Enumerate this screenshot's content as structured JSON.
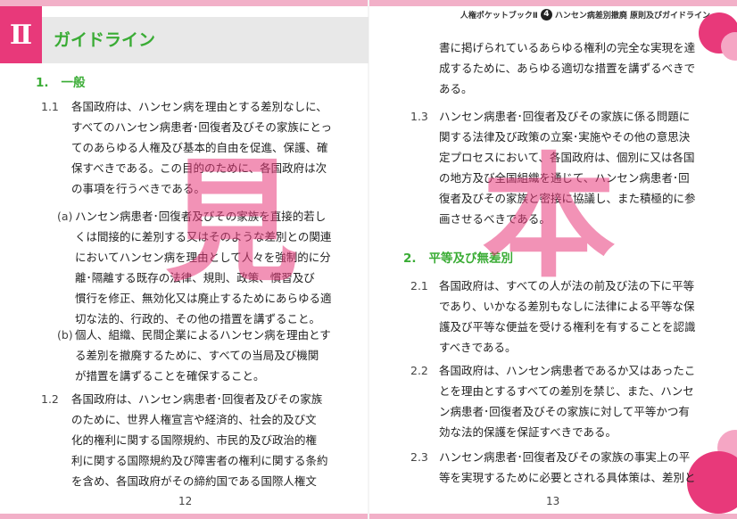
{
  "header": {
    "chapter_badge": "Ⅱ",
    "chapter_title": "ガイドライン",
    "running_title": "人権ポケットブックⅡ",
    "running_num": "4",
    "running_subtitle": "ハンセン病差別撤廃 原則及びガイドライン"
  },
  "left_page": {
    "section1": {
      "num": "1.",
      "title": "一般"
    },
    "p1_1": {
      "num": "1.1",
      "lines": [
        "各国政府は、ハンセン病を理由とする差別なしに、",
        "すべてのハンセン病患者･回復者及びその家族にとっ",
        "てのあらゆる人権及び基本的自由を促進、保護、確",
        "保すべきである。この目的のために、各国政府は次",
        "の事項を行うべきである。"
      ]
    },
    "item_a": {
      "label": "(a)",
      "lines": [
        "ハンセン病患者･回復者及びその家族を直接的若し",
        "くは間接的に差別する又はそのような差別との関連",
        "においてハンセン病を理由として人々を強制的に分",
        "離･隔離する既存の法律、規則、政策、慣習及び",
        "慣行を修正、無効化又は廃止するためにあらゆる適",
        "切な法的、行政的、その他の措置を講ずること。"
      ]
    },
    "item_b": {
      "label": "(b)",
      "lines": [
        "個人、組織、民間企業によるハンセン病を理由とす",
        "る差別を撤廃するために、すべての当局及び機関",
        "が措置を講ずることを確保すること。"
      ]
    },
    "p1_2": {
      "num": "1.2",
      "lines": [
        "各国政府は、ハンセン病患者･回復者及びその家族",
        "のために、世界人権宣言や経済的、社会的及び文",
        "化的権利に関する国際規約、市民的及び政治的権",
        "利に関する国際規約及び障害者の権利に関する条約",
        "を含め、各国政府がその締約国である国際人権文"
      ]
    },
    "page_number": "12",
    "watermark": "見"
  },
  "right_page": {
    "cont": {
      "lines": [
        "書に掲げられているあらゆる権利の完全な実現を達",
        "成するために、あらゆる適切な措置を講ずるべきで",
        "ある。"
      ]
    },
    "p1_3": {
      "num": "1.3",
      "lines": [
        "ハンセン病患者･回復者及びその家族に係る問題に",
        "関する法律及び政策の立案･実施やその他の意思決",
        "定プロセスにおいて、各国政府は、個別に又は各国",
        "の地方及び全国組織を通じて、ハンセン病患者･回",
        "復者及びその家族と密接に協議し、また積極的に参",
        "画させるべきである。"
      ]
    },
    "section2": {
      "num": "2.",
      "title": "平等及び無差別"
    },
    "p2_1": {
      "num": "2.1",
      "lines": [
        "各国政府は、すべての人が法の前及び法の下に平等",
        "であり、いかなる差別もなしに法律による平等な保",
        "護及び平等な便益を受ける権利を有することを認識",
        "すべきである。"
      ]
    },
    "p2_2": {
      "num": "2.2",
      "lines": [
        "各国政府は、ハンセン病患者であるか又はあったこ",
        "とを理由とするすべての差別を禁じ、また、ハンセ",
        "ン病患者･回復者及びその家族に対して平等かつ有",
        "効な法的保護を保証すべきである。"
      ]
    },
    "p2_3": {
      "num": "2.3",
      "lines": [
        "ハンセン病患者･回復者及びその家族の事実上の平",
        "等を実現するために必要とされる具体策は、差別と"
      ]
    },
    "page_number": "13",
    "watermark": "本"
  }
}
